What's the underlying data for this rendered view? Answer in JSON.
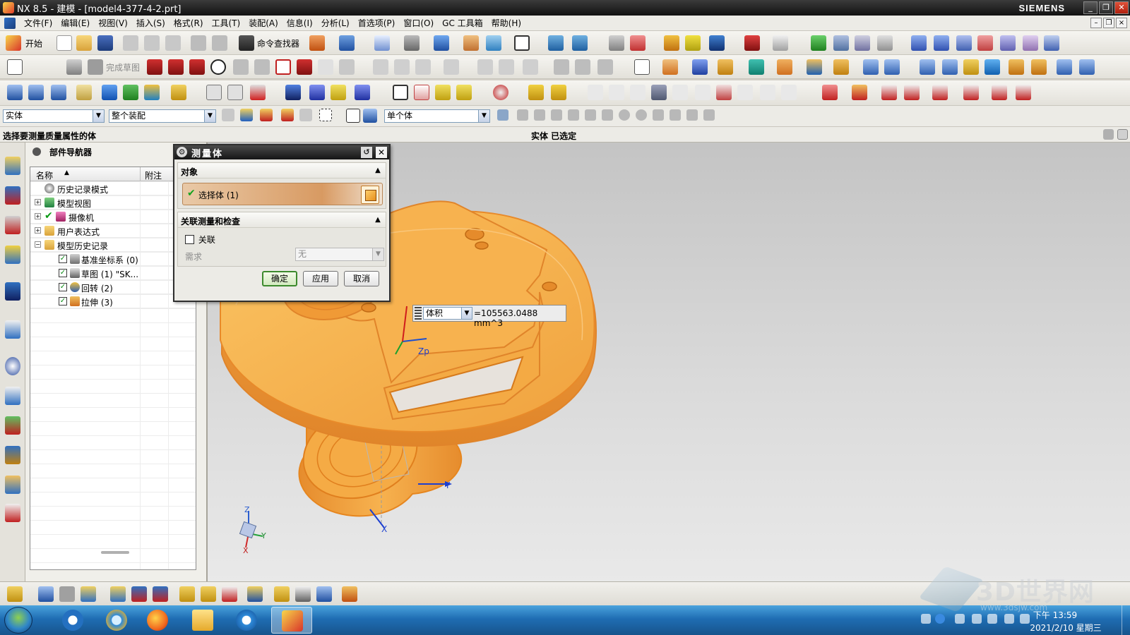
{
  "window": {
    "title": "NX 8.5 - 建模 - [model4-377-4-2.prt]",
    "brand": "SIEMENS",
    "min_label": "_",
    "max_label": "❐",
    "close_label": "✕"
  },
  "menu": {
    "items": [
      "文件(F)",
      "编辑(E)",
      "视图(V)",
      "插入(S)",
      "格式(R)",
      "工具(T)",
      "装配(A)",
      "信息(I)",
      "分析(L)",
      "首选项(P)",
      "窗口(O)",
      "GC 工具箱",
      "帮助(H)"
    ]
  },
  "toolbar": {
    "start_label": "开始",
    "command_finder_label": "命令查找器",
    "finish_sketch_label": "完成草图"
  },
  "selection_bar": {
    "type_filter": "实体",
    "scope_filter": "整个装配",
    "body_rule": "单个体"
  },
  "status": {
    "prompt": "选择要测量质量属性的体",
    "message": "实体 已选定"
  },
  "navigator": {
    "title": "部件导航器",
    "col_name": "名称",
    "col_note": "附注",
    "rows": [
      {
        "label": "历史记录模式",
        "level": 0,
        "expander": "",
        "checked": false
      },
      {
        "label": "模型视图",
        "level": 0,
        "expander": "+",
        "checked": false
      },
      {
        "label": "摄像机",
        "level": 0,
        "expander": "+",
        "checked": true
      },
      {
        "label": "用户表达式",
        "level": 0,
        "expander": "+",
        "checked": false
      },
      {
        "label": "模型历史记录",
        "level": 0,
        "expander": "-",
        "checked": false
      },
      {
        "label": "基准坐标系 (0)",
        "level": 1,
        "expander": "",
        "checked": true
      },
      {
        "label": "草图 (1) \"SK...",
        "level": 1,
        "expander": "",
        "checked": true
      },
      {
        "label": "回转 (2)",
        "level": 1,
        "expander": "",
        "checked": true
      },
      {
        "label": "拉伸 (3)",
        "level": 1,
        "expander": "",
        "checked": true
      }
    ]
  },
  "dialog": {
    "title": "测量体",
    "object_group": "对象",
    "select_label": "选择体 (1)",
    "assoc_group": "关联测量和检查",
    "assoc_checkbox": "关联",
    "requirement_label": "需求",
    "requirement_value": "无",
    "ok": "确定",
    "apply": "应用",
    "cancel": "取消"
  },
  "measurement": {
    "quantity": "体积",
    "value": "=105563.0488 mm^3"
  },
  "axes": {
    "zp": "Zp",
    "y": "Y",
    "x": "X",
    "z": "Z"
  },
  "taskbar": {
    "time": "下午 13:59",
    "date": "2021/2/10 星期三"
  },
  "watermark": {
    "text": "3D世界网",
    "url": "www.3dsjw.com"
  },
  "colors": {
    "part_fill": "#f3a646",
    "part_edge": "#e88a2a",
    "title_bar": "#1b1b1b",
    "taskbar": "#1f6db3"
  }
}
